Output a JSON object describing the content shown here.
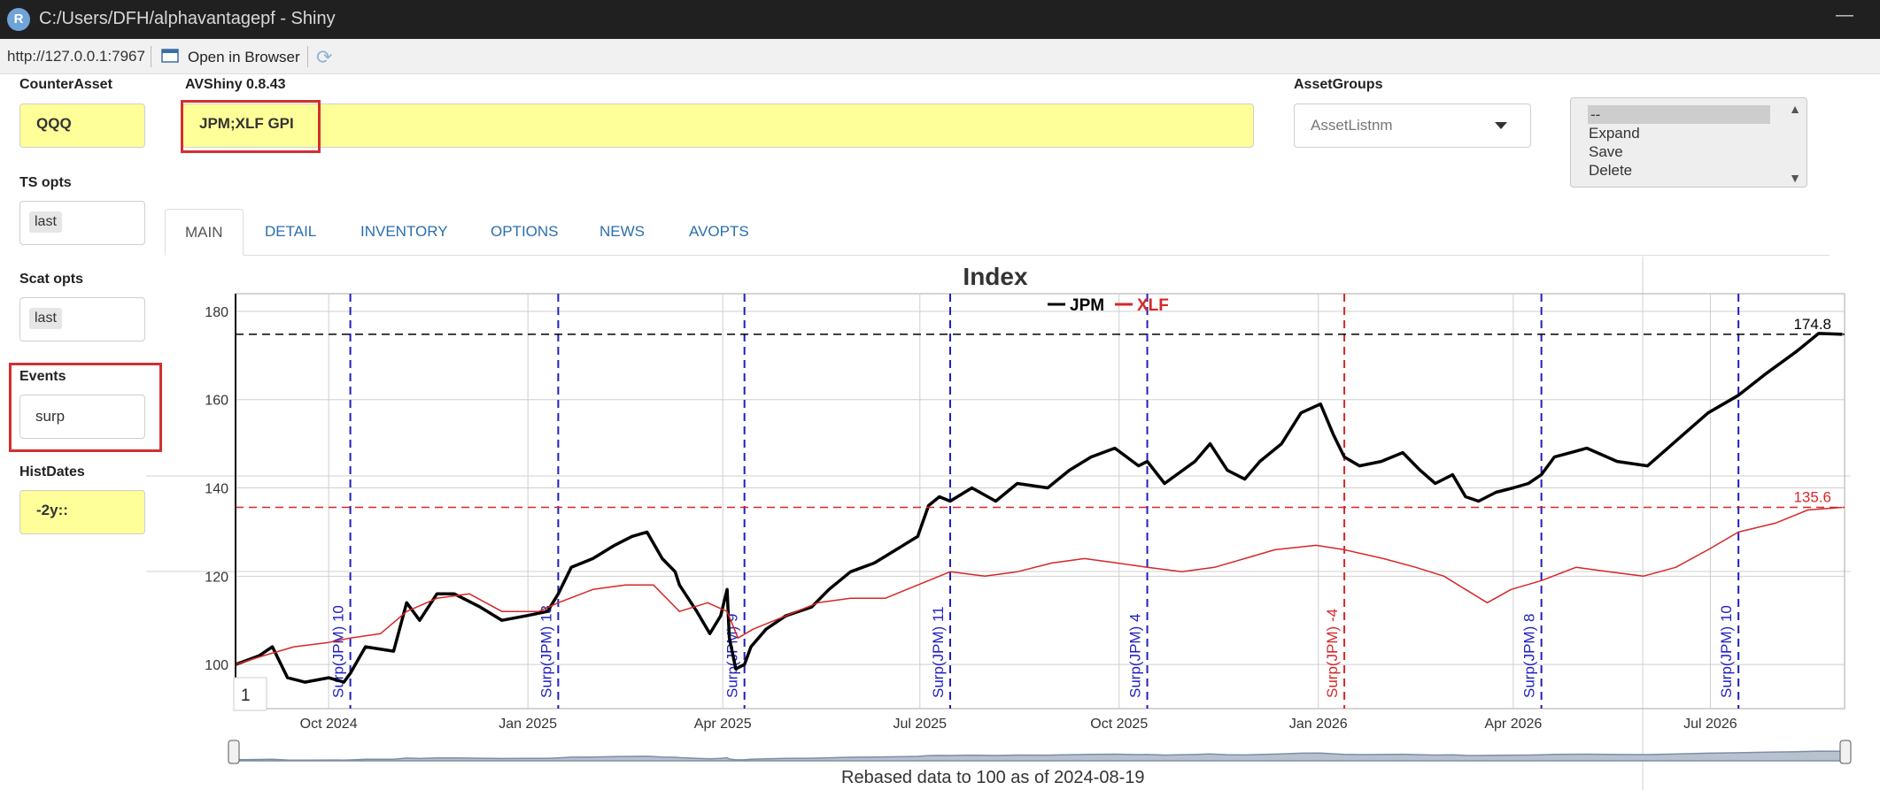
{
  "window": {
    "title": "C:/Users/DFH/alphavantagepf - Shiny",
    "app_icon_letter": "R",
    "minimize_glyph": "—"
  },
  "address_bar": {
    "url": "http://127.0.0.1:7967",
    "open_in_browser": "Open in Browser"
  },
  "counter_asset": {
    "label": "CounterAsset",
    "value": "QQQ"
  },
  "app": {
    "version_label": "AVShiny 0.8.43",
    "symbols_value": "JPM;XLF GPI"
  },
  "asset_groups": {
    "label": "AssetGroups",
    "selected": "AssetListnm"
  },
  "action_list": {
    "options": [
      "--",
      "Expand",
      "Save",
      "Delete"
    ]
  },
  "ts_opts": {
    "label": "TS opts",
    "value": "last"
  },
  "scat_opts": {
    "label": "Scat opts",
    "value": "last"
  },
  "events": {
    "label": "Events",
    "value": "surp"
  },
  "hist_dates": {
    "label": "HistDates",
    "value": "-2y::"
  },
  "tabs": [
    {
      "label": "MAIN",
      "active": true
    },
    {
      "label": "DETAIL",
      "active": false
    },
    {
      "label": "INVENTORY",
      "active": false
    },
    {
      "label": "OPTIONS",
      "active": false
    },
    {
      "label": "NEWS",
      "active": false
    },
    {
      "label": "AVOPTS",
      "active": false
    }
  ],
  "colors": {
    "jpm": "#000000",
    "xlf": "#d62728",
    "event_blue": "#1f1fbf",
    "event_red": "#d62728",
    "input_yellow": "#ffff99",
    "highlight_red": "#d32f2f"
  },
  "chart_data": {
    "type": "line",
    "title": "Index",
    "caption": "Rebased data to 100 as of 2024-08-19",
    "x_range": [
      "2024-08-19",
      "2026-09-01"
    ],
    "y_range": [
      90,
      184
    ],
    "y_ticks": [
      100,
      120,
      140,
      160,
      180
    ],
    "x_ticks": [
      {
        "label": "Oct 2024",
        "date": "2024-10-01"
      },
      {
        "label": "Jan 2025",
        "date": "2025-01-01"
      },
      {
        "label": "Apr 2025",
        "date": "2025-04-01"
      },
      {
        "label": "Jul 2025",
        "date": "2025-07-01"
      },
      {
        "label": "Oct 2025",
        "date": "2025-10-01"
      },
      {
        "label": "Jan 2026",
        "date": "2026-01-01"
      },
      {
        "label": "Apr 2026",
        "date": "2026-04-01"
      },
      {
        "label": "Jul 2026",
        "date": "2026-07-01"
      }
    ],
    "legend": {
      "placement": "top-center",
      "entries": [
        "JPM",
        "XLF"
      ]
    },
    "last_values": [
      {
        "series": "JPM",
        "value": 174.8,
        "label": "174.8"
      },
      {
        "series": "XLF",
        "value": 135.6,
        "label": "135.6"
      }
    ],
    "corner_label": "1",
    "events": [
      {
        "date": "2024-10-11",
        "label": "Surp(JPM) 10",
        "color": "blue"
      },
      {
        "date": "2025-01-15",
        "label": "Surp(JPM) 13",
        "color": "blue"
      },
      {
        "date": "2025-04-11",
        "label": "Surp(JPM) 9",
        "color": "blue"
      },
      {
        "date": "2025-07-15",
        "label": "Surp(JPM) 11",
        "color": "blue"
      },
      {
        "date": "2025-10-14",
        "label": "Surp(JPM) 4",
        "color": "blue"
      },
      {
        "date": "2026-01-13",
        "label": "Surp(JPM) -4",
        "color": "red"
      },
      {
        "date": "2026-04-14",
        "label": "Surp(JPM) 8",
        "color": "blue"
      },
      {
        "date": "2026-07-14",
        "label": "Surp(JPM) 10",
        "color": "blue"
      }
    ],
    "series": [
      {
        "name": "JPM",
        "points": [
          [
            "2024-08-19",
            100
          ],
          [
            "2024-08-30",
            102
          ],
          [
            "2024-09-05",
            104
          ],
          [
            "2024-09-12",
            97
          ],
          [
            "2024-09-20",
            96
          ],
          [
            "2024-10-01",
            97
          ],
          [
            "2024-10-08",
            96
          ],
          [
            "2024-10-11",
            98
          ],
          [
            "2024-10-18",
            104
          ],
          [
            "2024-10-31",
            103
          ],
          [
            "2024-11-06",
            114
          ],
          [
            "2024-11-12",
            110
          ],
          [
            "2024-11-20",
            116
          ],
          [
            "2024-11-28",
            116
          ],
          [
            "2024-12-10",
            113
          ],
          [
            "2024-12-20",
            110
          ],
          [
            "2024-12-31",
            111
          ],
          [
            "2025-01-10",
            112
          ],
          [
            "2025-01-15",
            116
          ],
          [
            "2025-01-21",
            122
          ],
          [
            "2025-01-31",
            124
          ],
          [
            "2025-02-10",
            127
          ],
          [
            "2025-02-18",
            129
          ],
          [
            "2025-02-25",
            130
          ],
          [
            "2025-03-04",
            124
          ],
          [
            "2025-03-10",
            121
          ],
          [
            "2025-03-12",
            118
          ],
          [
            "2025-03-20",
            112
          ],
          [
            "2025-03-26",
            107
          ],
          [
            "2025-03-31",
            111
          ],
          [
            "2025-04-03",
            117
          ],
          [
            "2025-04-04",
            106
          ],
          [
            "2025-04-07",
            99
          ],
          [
            "2025-04-11",
            100
          ],
          [
            "2025-04-14",
            104
          ],
          [
            "2025-04-21",
            108
          ],
          [
            "2025-04-30",
            111
          ],
          [
            "2025-05-12",
            113
          ],
          [
            "2025-05-20",
            117
          ],
          [
            "2025-05-30",
            121
          ],
          [
            "2025-06-10",
            123
          ],
          [
            "2025-06-20",
            126
          ],
          [
            "2025-06-30",
            129
          ],
          [
            "2025-07-05",
            136
          ],
          [
            "2025-07-10",
            138
          ],
          [
            "2025-07-15",
            137
          ],
          [
            "2025-07-25",
            140
          ],
          [
            "2025-08-05",
            137
          ],
          [
            "2025-08-15",
            141
          ],
          [
            "2025-08-29",
            140
          ],
          [
            "2025-09-08",
            144
          ],
          [
            "2025-09-18",
            147
          ],
          [
            "2025-09-29",
            149
          ],
          [
            "2025-10-10",
            145
          ],
          [
            "2025-10-14",
            146
          ],
          [
            "2025-10-22",
            141
          ],
          [
            "2025-11-05",
            146
          ],
          [
            "2025-11-12",
            150
          ],
          [
            "2025-11-20",
            144
          ],
          [
            "2025-11-28",
            142
          ],
          [
            "2025-12-05",
            146
          ],
          [
            "2025-12-15",
            150
          ],
          [
            "2025-12-24",
            157
          ],
          [
            "2026-01-02",
            159
          ],
          [
            "2026-01-08",
            152
          ],
          [
            "2026-01-13",
            147
          ],
          [
            "2026-01-20",
            145
          ],
          [
            "2026-01-30",
            146
          ],
          [
            "2026-02-09",
            148
          ],
          [
            "2026-02-17",
            144
          ],
          [
            "2026-02-24",
            141
          ],
          [
            "2026-03-04",
            143
          ],
          [
            "2026-03-10",
            138
          ],
          [
            "2026-03-16",
            137
          ],
          [
            "2026-03-24",
            139
          ],
          [
            "2026-04-01",
            140
          ],
          [
            "2026-04-08",
            141
          ],
          [
            "2026-04-14",
            143
          ],
          [
            "2026-04-20",
            147
          ],
          [
            "2026-05-05",
            149
          ],
          [
            "2026-05-19",
            146
          ],
          [
            "2026-06-02",
            145
          ],
          [
            "2026-06-16",
            151
          ],
          [
            "2026-06-30",
            157
          ],
          [
            "2026-07-14",
            161
          ],
          [
            "2026-07-27",
            166
          ],
          [
            "2026-08-10",
            171
          ],
          [
            "2026-08-20",
            175
          ],
          [
            "2026-08-31",
            174.8
          ]
        ]
      },
      {
        "name": "XLF",
        "points": [
          [
            "2024-08-19",
            100
          ],
          [
            "2024-09-01",
            102
          ],
          [
            "2024-09-15",
            104
          ],
          [
            "2024-10-01",
            105
          ],
          [
            "2024-10-11",
            106
          ],
          [
            "2024-10-25",
            107
          ],
          [
            "2024-11-06",
            112
          ],
          [
            "2024-11-20",
            115
          ],
          [
            "2024-12-05",
            116
          ],
          [
            "2024-12-20",
            112
          ],
          [
            "2025-01-06",
            112
          ],
          [
            "2025-01-15",
            114
          ],
          [
            "2025-01-31",
            117
          ],
          [
            "2025-02-15",
            118
          ],
          [
            "2025-02-28",
            118
          ],
          [
            "2025-03-12",
            112
          ],
          [
            "2025-03-25",
            114
          ],
          [
            "2025-04-03",
            112
          ],
          [
            "2025-04-08",
            106
          ],
          [
            "2025-04-15",
            108
          ],
          [
            "2025-04-30",
            111
          ],
          [
            "2025-05-15",
            114
          ],
          [
            "2025-05-30",
            115
          ],
          [
            "2025-06-15",
            115
          ],
          [
            "2025-06-30",
            118
          ],
          [
            "2025-07-15",
            121
          ],
          [
            "2025-07-31",
            120
          ],
          [
            "2025-08-15",
            121
          ],
          [
            "2025-08-31",
            123
          ],
          [
            "2025-09-15",
            124
          ],
          [
            "2025-09-30",
            123
          ],
          [
            "2025-10-14",
            122
          ],
          [
            "2025-10-30",
            121
          ],
          [
            "2025-11-14",
            122
          ],
          [
            "2025-11-28",
            124
          ],
          [
            "2025-12-12",
            126
          ],
          [
            "2025-12-31",
            127
          ],
          [
            "2026-01-13",
            126
          ],
          [
            "2026-01-31",
            124
          ],
          [
            "2026-02-15",
            122
          ],
          [
            "2026-02-28",
            120
          ],
          [
            "2026-03-10",
            117
          ],
          [
            "2026-03-20",
            114
          ],
          [
            "2026-03-31",
            117
          ],
          [
            "2026-04-14",
            119
          ],
          [
            "2026-04-30",
            122
          ],
          [
            "2026-05-15",
            121
          ],
          [
            "2026-05-31",
            120
          ],
          [
            "2026-06-15",
            122
          ],
          [
            "2026-06-30",
            126
          ],
          [
            "2026-07-14",
            130
          ],
          [
            "2026-07-31",
            132
          ],
          [
            "2026-08-15",
            135
          ],
          [
            "2026-08-31",
            135.6
          ]
        ]
      }
    ]
  }
}
